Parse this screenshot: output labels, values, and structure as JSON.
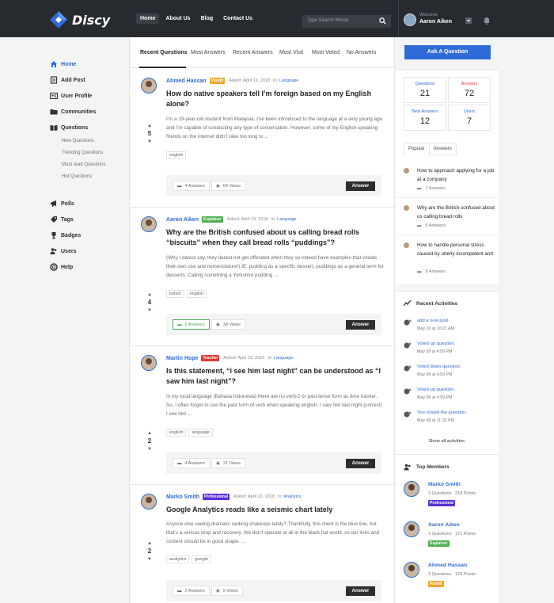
{
  "app": {
    "logo_text": "Discy"
  },
  "nav": [
    {
      "label": "Home"
    },
    {
      "label": "About Us"
    },
    {
      "label": "Blog"
    },
    {
      "label": "Contact Us"
    }
  ],
  "search": {
    "placeholder": "Type Search Words"
  },
  "user": {
    "welcome": "Welcome",
    "name": "Aaron Aiken"
  },
  "sidebar": {
    "items": [
      {
        "label": "Home",
        "icon": "home-icon"
      },
      {
        "label": "Add Post",
        "icon": "add-post-icon"
      },
      {
        "label": "User Profile",
        "icon": "user-profile-icon"
      },
      {
        "label": "Communities",
        "icon": "folder-icon"
      },
      {
        "label": "Questions",
        "icon": "book-icon"
      }
    ],
    "subitems": [
      "New Questions",
      "Trending Questions",
      "Must read Questions",
      "Hot Questions"
    ],
    "items2": [
      {
        "label": "Polls",
        "icon": "megaphone-icon"
      },
      {
        "label": "Tags",
        "icon": "tag-icon"
      },
      {
        "label": "Badges",
        "icon": "trophy-icon"
      },
      {
        "label": "Users",
        "icon": "users-icon"
      },
      {
        "label": "Help",
        "icon": "help-icon"
      }
    ]
  },
  "tabs": [
    "Recent Questions",
    "Most Answers",
    "Recent Answers",
    "Most Visit",
    "Most Voted",
    "No Answers"
  ],
  "questions": [
    {
      "author": "Ahmed Hassan",
      "badge": "Pundit",
      "badge_color": "#f4a623",
      "asked": "Asked: April 19, 2018",
      "in_label": "In:",
      "category": "Language",
      "votes": "5",
      "title": "How do native speakers tell I’m foreign based on my English alone?",
      "excerpt": "I’m a 19-year-old student from Malaysia. I’ve been introduced to the language at a very young age and I’m capable of conducting any type of conversation. However, some of my English-speaking friends on the internet didn’t take too long to ...",
      "tags": [
        "english"
      ],
      "answers": "4 Answers",
      "views": "64 Views",
      "answers_highlight": false,
      "answer_btn": "Answer"
    },
    {
      "author": "Aaron Aiken",
      "badge": "Explainer",
      "badge_color": "#4caf50",
      "asked": "Asked: April 19, 2018",
      "in_label": "In:",
      "category": "Language",
      "votes": "4",
      "title": "Why are the British confused about us calling bread rolls “biscuits” when they call bread rolls “puddings”?",
      "excerpt": "(Why I darest say, they darest not get offended when they so indeed have examples that violate their own use and nomenclature!) IE: pudding as a specific dessert, puddings as a general term for desserts. Calling something a Yorkshire pudding ...",
      "tags": [
        "british",
        "english"
      ],
      "answers": "5 Answers",
      "views": "34 Views",
      "answers_highlight": true,
      "answer_btn": "Answer"
    },
    {
      "author": "Martin Hope",
      "badge": "Teacher",
      "badge_color": "#e53935",
      "asked": "Asked: April 19, 2018",
      "in_label": "In:",
      "category": "Language",
      "votes": "2",
      "title": "Is this statement, “i see him last night” can be understood as “I saw him last night”?",
      "excerpt": "In my local language (Bahasa Indonesia) there are no verb-2 or past tense form as time tracker. So, I often forget to use the past form of verb when speaking english. I saw him last night (correct) I see him ...",
      "tags": [
        "english",
        "language"
      ],
      "answers": "4 Answers",
      "views": "21 Views",
      "answers_highlight": false,
      "answer_btn": "Answer"
    },
    {
      "author": "Marko Smith",
      "badge": "Professional",
      "badge_color": "#5b2fd6",
      "asked": "Asked: April 19, 2018",
      "in_label": "In:",
      "category": "Analytics",
      "votes": "2",
      "title": "Google Analytics reads like a seismic chart lately",
      "excerpt": "Anyone else seeing dramatic ranking shakeups lately? Thankfully, this client is the blue line, but that’s a serious drop and recovery. We don’t operate at all in the black hat world, so our links and content should be in good shape. ...",
      "tags": [
        "analytics",
        "google"
      ],
      "answers": "2 Answers",
      "views": "5 Views",
      "answers_highlight": false,
      "answer_btn": "Answer"
    }
  ],
  "right": {
    "ask_button": "Ask A Question",
    "stats": [
      {
        "label": "Questions",
        "value": "21",
        "color": "#2e6bd6"
      },
      {
        "label": "Answers",
        "value": "72",
        "color": "#e53935"
      },
      {
        "label": "Best Answers",
        "value": "12",
        "color": "#2e6bd6"
      },
      {
        "label": "Users",
        "value": "7",
        "color": "#2e6bd6"
      }
    ],
    "pop_tabs": [
      "Popular",
      "Answers"
    ],
    "popular": [
      {
        "title": "How to approach applying for a job at a company",
        "count": "7 Answers"
      },
      {
        "title": "Why are the British confused about us calling bread rolls",
        "count": "5 Answers"
      },
      {
        "title": "How to handle personal stress caused by utterly incompetent and",
        "count": "5 Answers"
      }
    ],
    "activities_title": "Recent Activities",
    "activities": [
      {
        "text": "add a new post.",
        "date": "May 10 at 10:21 AM"
      },
      {
        "text": "Voted up question.",
        "date": "May 09 at 4:59 PM"
      },
      {
        "text": "Voted down question.",
        "date": "May 09 at 4:59 PM"
      },
      {
        "text": "Voted up question.",
        "date": "May 09 at 4:59 PM"
      },
      {
        "text": "You closed the question.",
        "date": "May 08 at 11:32 PM"
      }
    ],
    "show_all": "Show all activities.",
    "members_title": "Top Members",
    "members": [
      {
        "name": "Marko Smith",
        "questions": "3 Questions",
        "points": "218 Points",
        "badge": "Professional",
        "badge_color": "#5b2fd6"
      },
      {
        "name": "Aaron Aiken",
        "questions": "2 Questions",
        "points": "171 Points",
        "badge": "Explainer",
        "badge_color": "#4caf50"
      },
      {
        "name": "Ahmed Hassan",
        "questions": "3 Questions",
        "points": "124 Points",
        "badge": "Pundit",
        "badge_color": "#f4a623"
      }
    ]
  }
}
